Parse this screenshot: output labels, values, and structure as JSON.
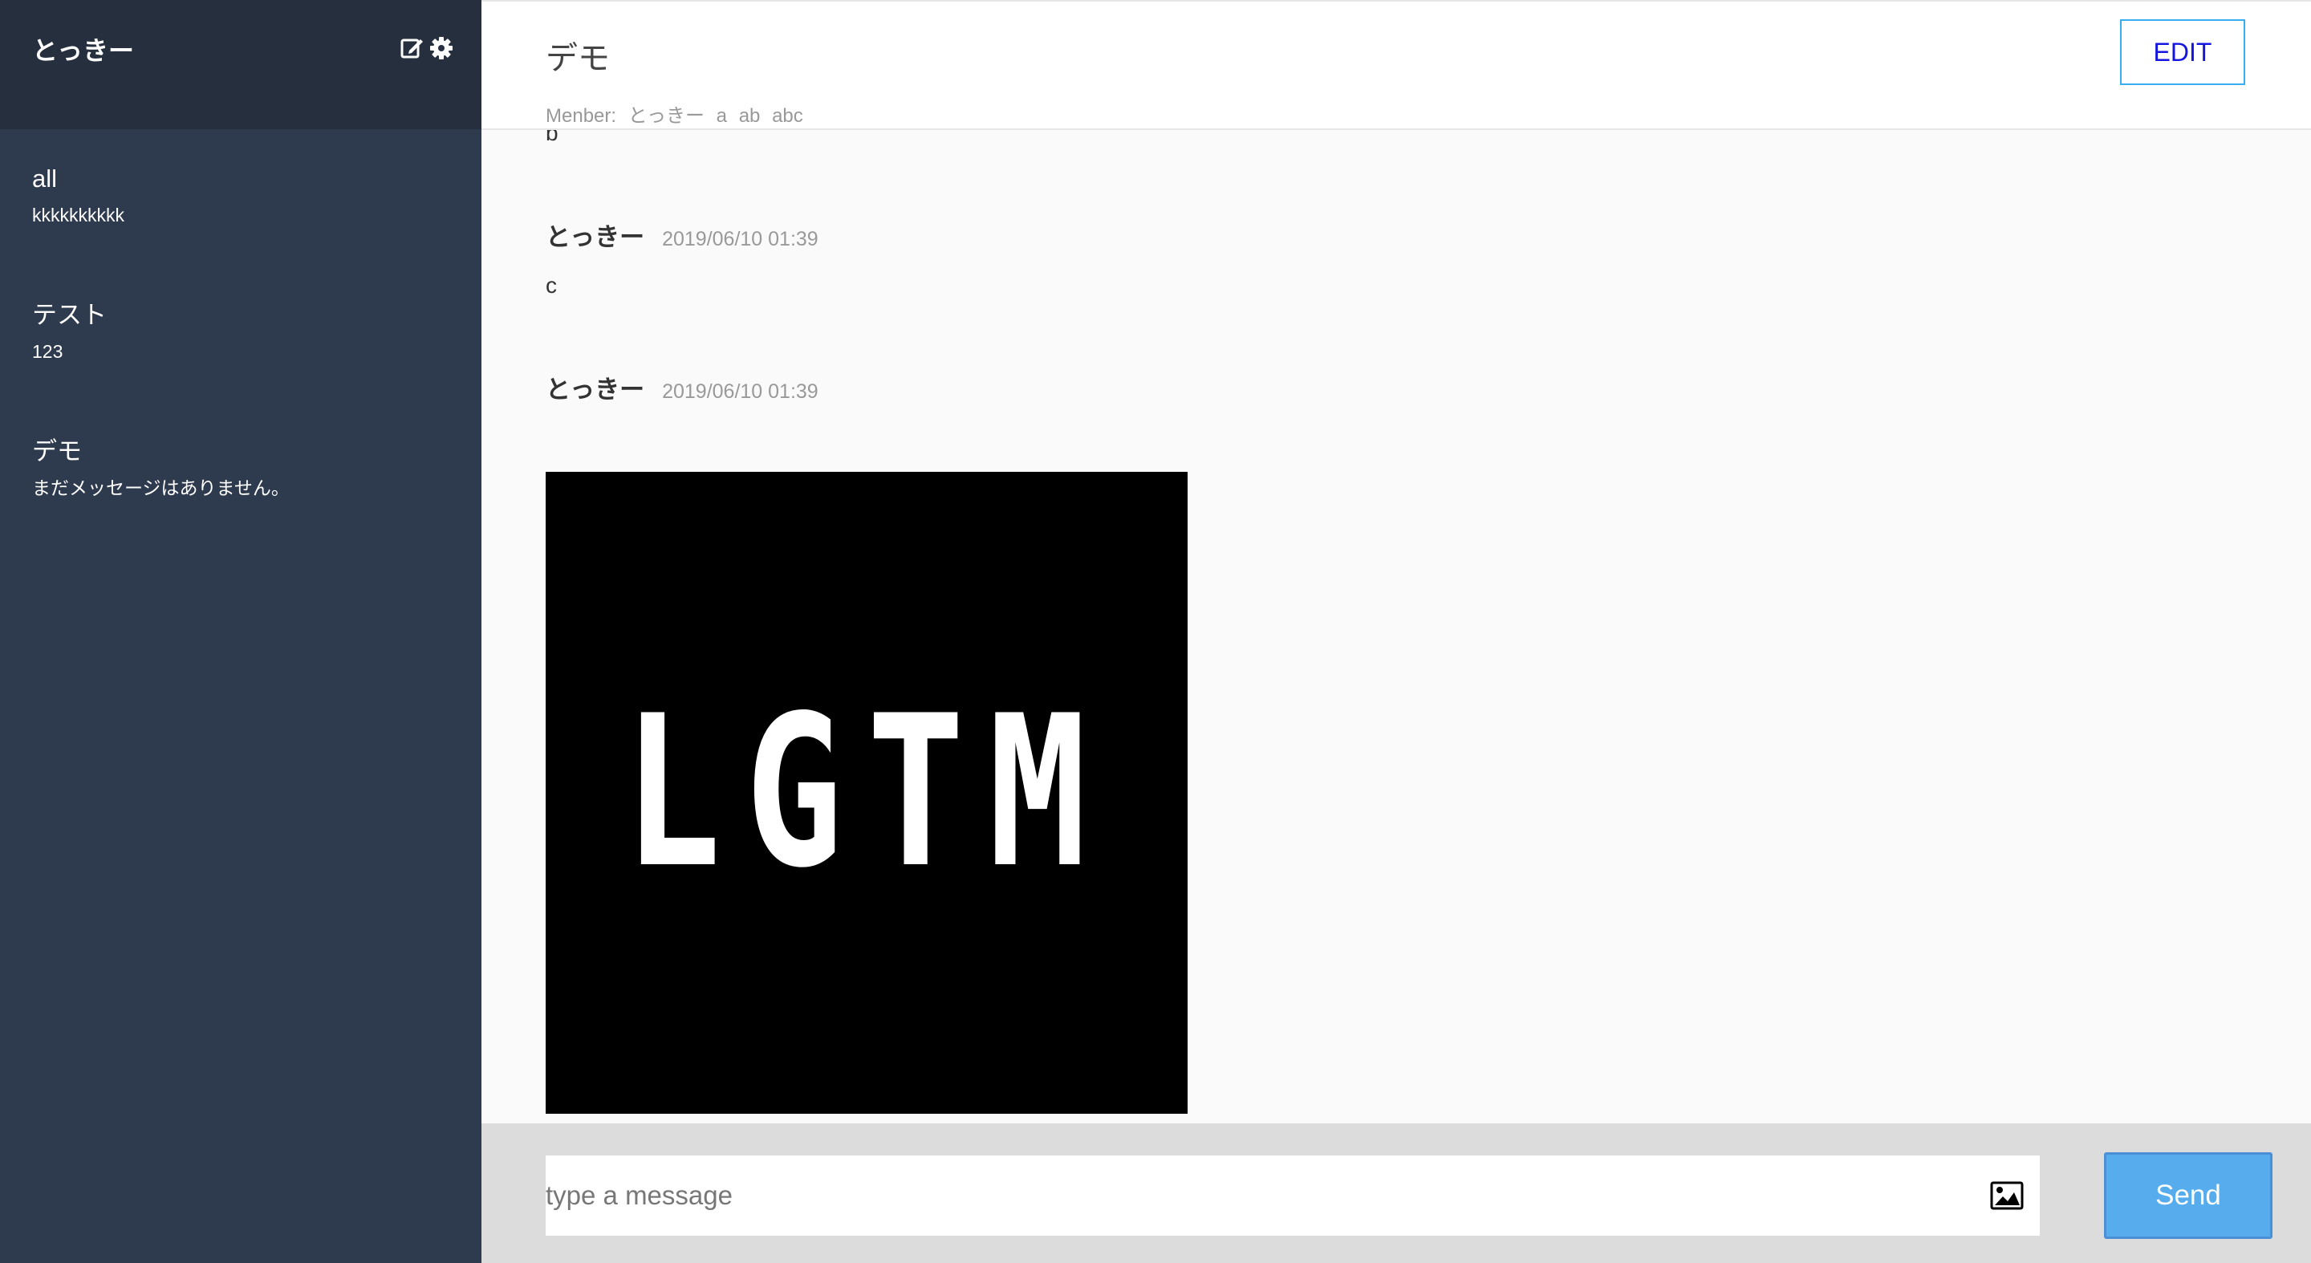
{
  "sidebar": {
    "user_name": "とっきー",
    "icons": [
      "edit-icon",
      "gear-icon"
    ],
    "groups": [
      {
        "name": "all",
        "last_message": "kkkkkkkkkk"
      },
      {
        "name": "テスト",
        "last_message": "123"
      },
      {
        "name": "デモ",
        "last_message": "まだメッセージはありません。"
      }
    ]
  },
  "header": {
    "title": "デモ",
    "member_label": "Menber:",
    "members": [
      "とっきー",
      "a",
      "ab",
      "abc"
    ],
    "edit_label": "EDIT"
  },
  "messages": [
    {
      "text": "b"
    },
    {
      "author": "とっきー",
      "time": "2019/06/10 01:39",
      "text": "c"
    },
    {
      "author": "とっきー",
      "time": "2019/06/10 01:39",
      "image_text": "LGTM"
    }
  ],
  "footer": {
    "input_placeholder": "type a message",
    "image_icon": "image-icon",
    "send_label": "Send"
  },
  "colors": {
    "sidebar_bg": "#2e3a4d",
    "sidebar_header_bg": "#252f3e",
    "send_button": "#56acec",
    "edit_text": "#1515e0"
  }
}
